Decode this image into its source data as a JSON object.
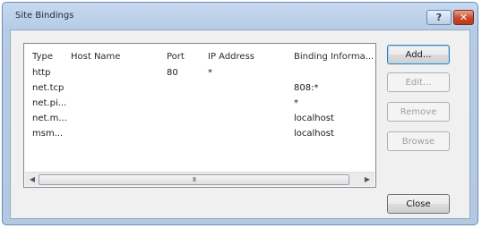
{
  "window": {
    "title": "Site Bindings"
  },
  "titlebar": {
    "help_label": "?",
    "close_label": "✕"
  },
  "table": {
    "columns": [
      "Type",
      "Host Name",
      "Port",
      "IP Address",
      "Binding Informa..."
    ],
    "rows": [
      [
        "http",
        "",
        "80",
        "*",
        ""
      ],
      [
        "net.tcp",
        "",
        "",
        "",
        "808:*"
      ],
      [
        "net.pi...",
        "",
        "",
        "",
        "*"
      ],
      [
        "net.m...",
        "",
        "",
        "",
        "localhost"
      ],
      [
        "msm...",
        "",
        "",
        "",
        "localhost"
      ]
    ]
  },
  "scrollbar": {
    "left_icon": "◀",
    "right_icon": "▶",
    "grip": "III"
  },
  "buttons": {
    "add": "Add...",
    "edit": "Edit...",
    "remove": "Remove",
    "browse": "Browse",
    "close": "Close"
  }
}
